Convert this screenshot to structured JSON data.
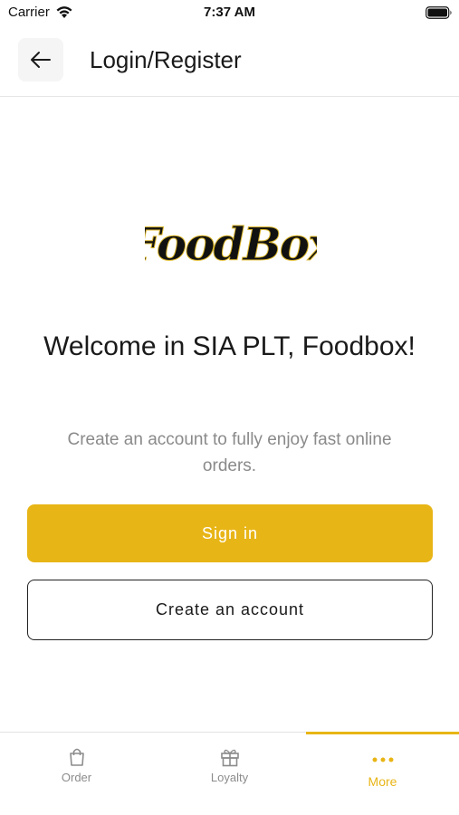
{
  "status_bar": {
    "carrier": "Carrier",
    "time": "7:37 AM"
  },
  "header": {
    "title": "Login/Register"
  },
  "logo": {
    "text": "FoodBox"
  },
  "main": {
    "welcome": "Welcome in SIA PLT, Foodbox!",
    "subtitle": "Create an account to fully enjoy fast online orders.",
    "signin_label": "Sign in",
    "create_label": "Create an account"
  },
  "tabbar": {
    "tabs": [
      {
        "label": "Order",
        "icon": "shopping-bag-icon"
      },
      {
        "label": "Loyalty",
        "icon": "gift-icon"
      },
      {
        "label": "More",
        "icon": "more-dots-icon"
      }
    ],
    "active_index": 2
  },
  "colors": {
    "accent": "#e8b516",
    "text": "#1a1a1a",
    "muted": "#8a8a8a"
  }
}
